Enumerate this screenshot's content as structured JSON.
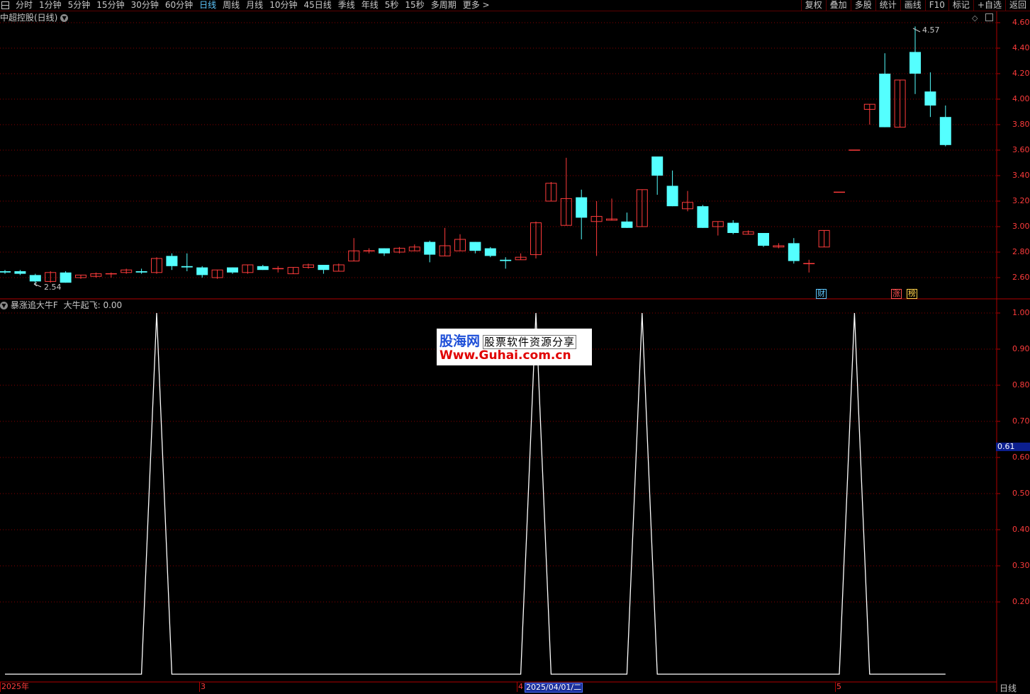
{
  "toolbar": {
    "periods": [
      "分时",
      "1分钟",
      "5分钟",
      "15分钟",
      "30分钟",
      "60分钟",
      "日线",
      "周线",
      "月线",
      "10分钟",
      "45日线",
      "季线",
      "年线",
      "5秒",
      "15秒",
      "多周期",
      "更多 >"
    ],
    "active_period": "日线",
    "right_buttons": [
      "复权",
      "叠加",
      "多股",
      "统计",
      "画线",
      "F10",
      "标记",
      "+自选",
      "返回"
    ]
  },
  "main_chart": {
    "title": "中超控股(日线)",
    "yticks": [
      "4.60",
      "4.40",
      "4.20",
      "4.00",
      "3.80",
      "3.60",
      "3.40",
      "3.20",
      "3.00",
      "2.80",
      "2.60"
    ],
    "high_label": "4.57",
    "low_label": "2.54",
    "event_badges": [
      {
        "text": "财",
        "color": "#5ec8ff"
      },
      {
        "text": "涨",
        "color": "#ff5050"
      },
      {
        "text": "榜",
        "color": "#ffd24a"
      }
    ]
  },
  "chart_data": {
    "type": "candlestick",
    "title": "中超控股(日线)",
    "ylim": [
      2.5,
      4.66
    ],
    "candles": [
      {
        "o": 2.65,
        "h": 2.66,
        "l": 2.63,
        "c": 2.64
      },
      {
        "o": 2.65,
        "h": 2.66,
        "l": 2.62,
        "c": 2.63
      },
      {
        "o": 2.62,
        "h": 2.63,
        "l": 2.54,
        "c": 2.57
      },
      {
        "o": 2.57,
        "h": 2.65,
        "l": 2.56,
        "c": 2.64
      },
      {
        "o": 2.64,
        "h": 2.65,
        "l": 2.56,
        "c": 2.56
      },
      {
        "o": 2.6,
        "h": 2.62,
        "l": 2.59,
        "c": 2.62
      },
      {
        "o": 2.61,
        "h": 2.64,
        "l": 2.6,
        "c": 2.63
      },
      {
        "o": 2.63,
        "h": 2.64,
        "l": 2.6,
        "c": 2.63
      },
      {
        "o": 2.64,
        "h": 2.67,
        "l": 2.63,
        "c": 2.66
      },
      {
        "o": 2.65,
        "h": 2.67,
        "l": 2.63,
        "c": 2.64
      },
      {
        "o": 2.64,
        "h": 2.76,
        "l": 2.63,
        "c": 2.75
      },
      {
        "o": 2.77,
        "h": 2.79,
        "l": 2.66,
        "c": 2.69
      },
      {
        "o": 2.69,
        "h": 2.79,
        "l": 2.65,
        "c": 2.68
      },
      {
        "o": 2.68,
        "h": 2.69,
        "l": 2.6,
        "c": 2.62
      },
      {
        "o": 2.6,
        "h": 2.66,
        "l": 2.59,
        "c": 2.66
      },
      {
        "o": 2.68,
        "h": 2.68,
        "l": 2.63,
        "c": 2.64
      },
      {
        "o": 2.64,
        "h": 2.7,
        "l": 2.63,
        "c": 2.7
      },
      {
        "o": 2.69,
        "h": 2.7,
        "l": 2.66,
        "c": 2.66
      },
      {
        "o": 2.67,
        "h": 2.69,
        "l": 2.64,
        "c": 2.67
      },
      {
        "o": 2.63,
        "h": 2.68,
        "l": 2.63,
        "c": 2.68
      },
      {
        "o": 2.68,
        "h": 2.71,
        "l": 2.67,
        "c": 2.7
      },
      {
        "o": 2.7,
        "h": 2.7,
        "l": 2.63,
        "c": 2.66
      },
      {
        "o": 2.65,
        "h": 2.71,
        "l": 2.65,
        "c": 2.7
      },
      {
        "o": 2.73,
        "h": 2.91,
        "l": 2.73,
        "c": 2.81
      },
      {
        "o": 2.81,
        "h": 2.83,
        "l": 2.79,
        "c": 2.81
      },
      {
        "o": 2.83,
        "h": 2.83,
        "l": 2.77,
        "c": 2.79
      },
      {
        "o": 2.8,
        "h": 2.84,
        "l": 2.79,
        "c": 2.83
      },
      {
        "o": 2.81,
        "h": 2.86,
        "l": 2.81,
        "c": 2.84
      },
      {
        "o": 2.88,
        "h": 2.89,
        "l": 2.72,
        "c": 2.78
      },
      {
        "o": 2.77,
        "h": 2.99,
        "l": 2.77,
        "c": 2.85
      },
      {
        "o": 2.81,
        "h": 2.94,
        "l": 2.81,
        "c": 2.9
      },
      {
        "o": 2.88,
        "h": 2.88,
        "l": 2.79,
        "c": 2.81
      },
      {
        "o": 2.83,
        "h": 2.84,
        "l": 2.76,
        "c": 2.77
      },
      {
        "o": 2.74,
        "h": 2.76,
        "l": 2.67,
        "c": 2.73
      },
      {
        "o": 2.74,
        "h": 2.79,
        "l": 2.74,
        "c": 2.76
      },
      {
        "o": 2.78,
        "h": 3.04,
        "l": 2.75,
        "c": 3.03
      },
      {
        "o": 3.2,
        "h": 3.35,
        "l": 3.2,
        "c": 3.34
      },
      {
        "o": 3.01,
        "h": 3.54,
        "l": 3.01,
        "c": 3.22
      },
      {
        "o": 3.23,
        "h": 3.29,
        "l": 2.9,
        "c": 3.07
      },
      {
        "o": 3.04,
        "h": 3.2,
        "l": 2.77,
        "c": 3.08
      },
      {
        "o": 3.05,
        "h": 3.22,
        "l": 3.05,
        "c": 3.06
      },
      {
        "o": 3.04,
        "h": 3.11,
        "l": 2.99,
        "c": 2.99
      },
      {
        "o": 3.0,
        "h": 3.29,
        "l": 3.0,
        "c": 3.29
      },
      {
        "o": 3.55,
        "h": 3.55,
        "l": 3.25,
        "c": 3.4
      },
      {
        "o": 3.32,
        "h": 3.44,
        "l": 3.16,
        "c": 3.16
      },
      {
        "o": 3.14,
        "h": 3.28,
        "l": 3.12,
        "c": 3.19
      },
      {
        "o": 3.16,
        "h": 3.17,
        "l": 2.99,
        "c": 2.99
      },
      {
        "o": 3.0,
        "h": 3.04,
        "l": 2.93,
        "c": 3.04
      },
      {
        "o": 3.03,
        "h": 3.05,
        "l": 2.94,
        "c": 2.95
      },
      {
        "o": 2.94,
        "h": 2.97,
        "l": 2.94,
        "c": 2.96
      },
      {
        "o": 2.95,
        "h": 2.95,
        "l": 2.84,
        "c": 2.85
      },
      {
        "o": 2.84,
        "h": 2.87,
        "l": 2.83,
        "c": 2.85
      },
      {
        "o": 2.87,
        "h": 2.91,
        "l": 2.71,
        "c": 2.73
      },
      {
        "o": 2.71,
        "h": 2.74,
        "l": 2.64,
        "c": 2.71
      },
      {
        "o": 2.84,
        "h": 2.97,
        "l": 2.84,
        "c": 2.97
      },
      {
        "o": 3.27,
        "h": 3.27,
        "l": 3.27,
        "c": 3.27
      },
      {
        "o": 3.6,
        "h": 3.6,
        "l": 3.6,
        "c": 3.6
      },
      {
        "o": 3.92,
        "h": 3.96,
        "l": 3.8,
        "c": 3.96
      },
      {
        "o": 4.2,
        "h": 4.36,
        "l": 3.78,
        "c": 3.78
      },
      {
        "o": 3.78,
        "h": 4.15,
        "l": 3.78,
        "c": 4.15
      },
      {
        "o": 4.37,
        "h": 4.57,
        "l": 4.04,
        "c": 4.2
      },
      {
        "o": 4.06,
        "h": 4.21,
        "l": 3.86,
        "c": 3.95
      },
      {
        "o": 3.86,
        "h": 3.95,
        "l": 3.63,
        "c": 3.64
      }
    ]
  },
  "indicator": {
    "name": "暴涨追大牛F",
    "line_label": "大牛起飞:",
    "line_value": "0.00",
    "yticks": [
      "1.00",
      "0.90",
      "0.80",
      "0.70",
      "0.60",
      "0.50",
      "0.40",
      "0.30",
      "0.20"
    ],
    "ylim": [
      0,
      1
    ],
    "signal": [
      0,
      0,
      0,
      0,
      0,
      0,
      0,
      0,
      0,
      0,
      1,
      0,
      0,
      0,
      0,
      0,
      0,
      0,
      0,
      0,
      0,
      0,
      0,
      0,
      0,
      0,
      0,
      0,
      0,
      0,
      0,
      0,
      0,
      0,
      0,
      1,
      0,
      0,
      0,
      0,
      0,
      0,
      1,
      0,
      0,
      0,
      0,
      0,
      0,
      0,
      0,
      0,
      0,
      0,
      0,
      0,
      1,
      0,
      0,
      0,
      0,
      0,
      0
    ],
    "cursor_value": "0.61"
  },
  "xaxis": {
    "labels": [
      "2025年",
      "3",
      "4",
      "5"
    ],
    "selected_date": "2025/04/01/二",
    "period": "日线"
  },
  "watermark": {
    "brand": "股海网",
    "tagline": "股票软件资源分享",
    "url": "Www.Guhai.com.cn"
  },
  "colors": {
    "up": "#ff3b3b",
    "down": "#54ffff",
    "grid": "#8a0000",
    "axis": "#b00000",
    "signal_line": "#ffffff"
  }
}
